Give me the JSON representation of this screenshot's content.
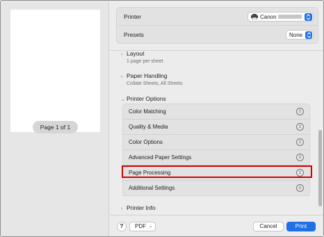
{
  "preview": {
    "page_indicator": "Page 1 of 1"
  },
  "printer": {
    "label": "Printer",
    "value": "Canon"
  },
  "presets": {
    "label": "Presets",
    "value": "None"
  },
  "sections": {
    "layout": {
      "title": "Layout",
      "summary": "1 page per sheet"
    },
    "paper_handling": {
      "title": "Paper Handling",
      "summary": "Collate Sheets, All Sheets"
    },
    "printer_options": {
      "title": "Printer Options"
    },
    "printer_info": {
      "title": "Printer Info"
    }
  },
  "options": [
    {
      "label": "Color Matching"
    },
    {
      "label": "Quality & Media"
    },
    {
      "label": "Color Options"
    },
    {
      "label": "Advanced Paper Settings"
    },
    {
      "label": "Page Processing",
      "highlighted": true
    },
    {
      "label": "Additional Settings"
    }
  ],
  "bottom": {
    "help": "?",
    "pdf": "PDF",
    "cancel": "Cancel",
    "print": "Print"
  },
  "colors": {
    "accent": "#1f6fe5",
    "highlight": "#d40000"
  },
  "icons": {
    "info": "info-icon",
    "chevron_right": "chevron-right-icon",
    "chevron_down": "chevron-down-icon"
  }
}
